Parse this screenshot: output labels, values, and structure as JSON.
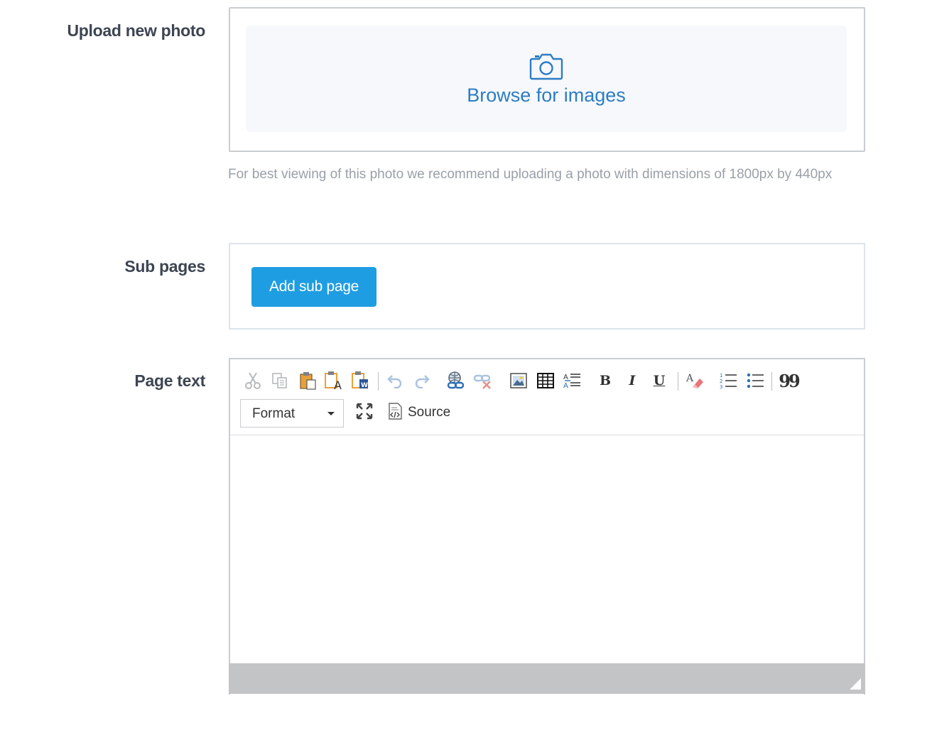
{
  "upload": {
    "label": "Upload new photo",
    "browse_text": "Browse for images",
    "hint": "For best viewing of this photo we recommend uploading a photo with dimensions of 1800px by 440px",
    "icon": "camera-icon"
  },
  "subpages": {
    "label": "Sub pages",
    "add_button": "Add sub page"
  },
  "pagetext": {
    "label": "Page text",
    "toolbar": {
      "format_label": "Format",
      "source_label": "Source",
      "bold": "B",
      "italic": "I",
      "underline": "U",
      "blockquote": "99"
    }
  },
  "colors": {
    "accent_blue": "#1f9de2",
    "link_blue": "#2d7cc4",
    "label_text": "#3d4552",
    "hint_text": "#9aa0a8"
  }
}
